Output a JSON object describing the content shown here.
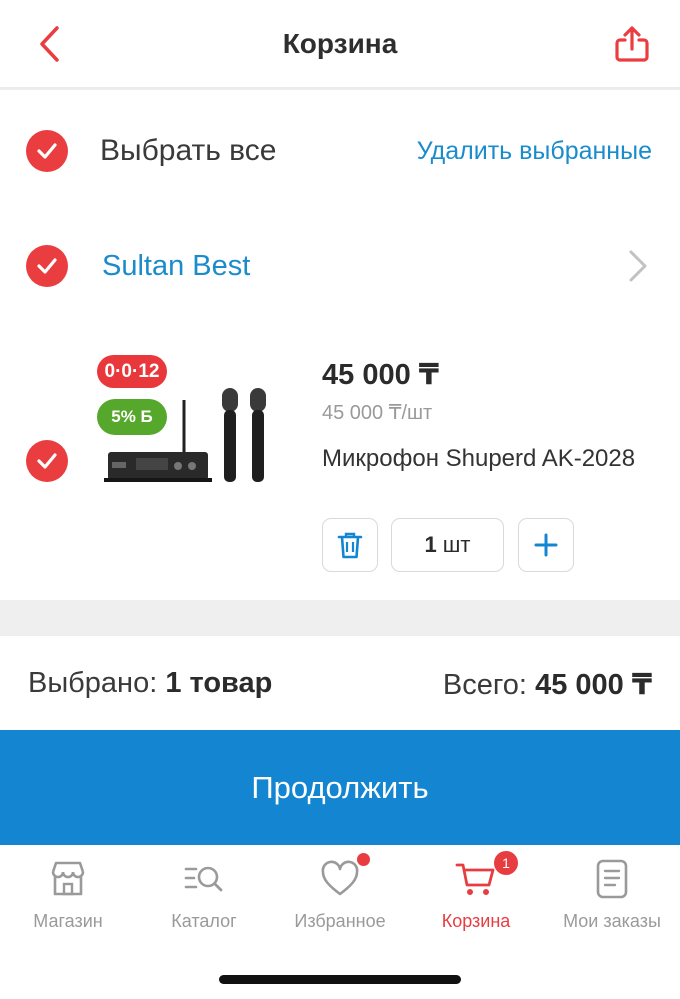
{
  "header": {
    "title": "Корзина",
    "back_icon": "chevron-left-icon",
    "share_icon": "share-icon"
  },
  "select_all": {
    "label": "Выбрать все",
    "delete_label": "Удалить выбранные",
    "checked": true
  },
  "seller": {
    "name": "Sultan Best",
    "checked": true
  },
  "item": {
    "checked": true,
    "badge_installment": "0·0·12",
    "badge_bonus": "5% Б",
    "price": "45 000 ₸",
    "unit_price": "45 000 ₸/шт",
    "name": "Микрофон Shuperd AK-2028",
    "qty_number": "1",
    "qty_unit": "шт"
  },
  "summary": {
    "selected_label": "Выбрано:",
    "selected_value": "1 товар",
    "total_label": "Всего:",
    "total_value": "45 000 ₸"
  },
  "continue_label": "Продолжить",
  "tabs": [
    {
      "label": "Магазин",
      "icon": "store-icon"
    },
    {
      "label": "Каталог",
      "icon": "catalog-search-icon"
    },
    {
      "label": "Избранное",
      "icon": "heart-icon"
    },
    {
      "label": "Корзина",
      "icon": "cart-icon",
      "badge": "1"
    },
    {
      "label": "Мои заказы",
      "icon": "orders-icon"
    }
  ],
  "colors": {
    "accent_red": "#ea3d40",
    "link_blue": "#1a8ccc",
    "primary_blue": "#1485d0",
    "bonus_green": "#55a82b"
  }
}
